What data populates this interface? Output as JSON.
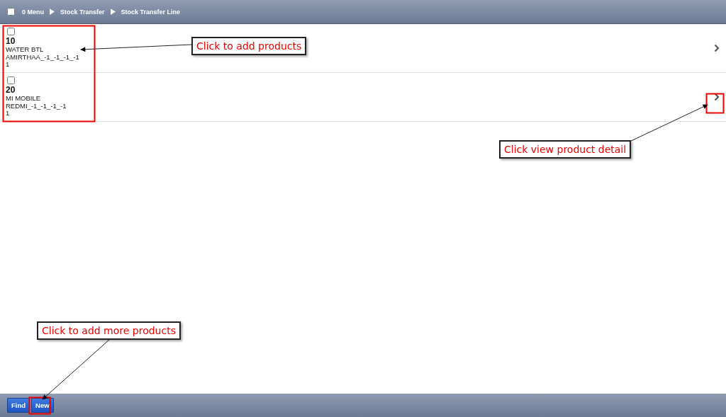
{
  "header": {
    "select_all_checked": false,
    "breadcrumb": [
      "0 Menu",
      "Stock Transfer",
      "Stock Transfer Line"
    ]
  },
  "lines": [
    {
      "checked": false,
      "line_no": "10",
      "product": "WATER BTL",
      "attributes": "AMIRTHAA_-1_-1_-1_-1",
      "quantity": "1"
    },
    {
      "checked": false,
      "line_no": "20",
      "product": "MI MOBILE",
      "attributes": "REDMI_-1_-1_-1_-1",
      "quantity": "1"
    }
  ],
  "footer": {
    "buttons": [
      "Find",
      "New"
    ]
  },
  "callouts": [
    "Click to add products",
    "Click view product detail",
    "Click to add more products"
  ]
}
